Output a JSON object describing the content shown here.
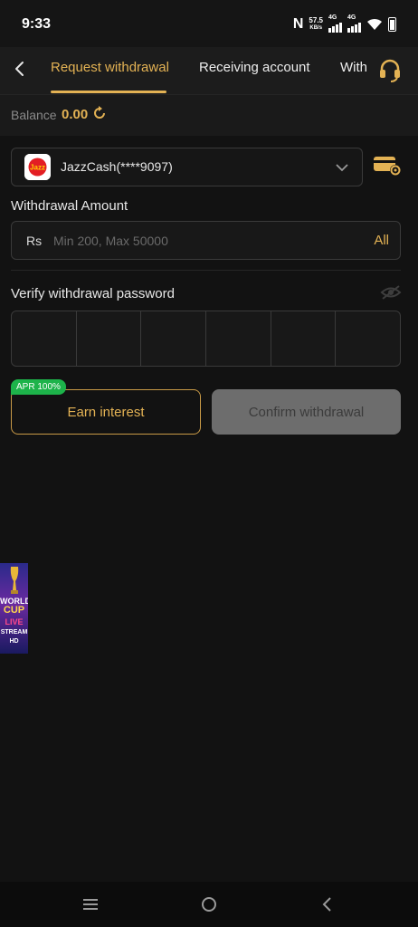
{
  "status_bar": {
    "time": "9:33",
    "network_speed": "57.5",
    "network_speed_unit": "KB/s",
    "signal_1_label": "4G",
    "signal_2_label": "4G",
    "n_icon": "N"
  },
  "tabs": [
    {
      "label": "Request withdrawal",
      "active": true
    },
    {
      "label": "Receiving account",
      "active": false
    },
    {
      "label": "Withdrawal record",
      "active": false
    }
  ],
  "balance": {
    "label": "Balance",
    "value": "0.00"
  },
  "account": {
    "name": "JazzCash(****9097)",
    "logo_text": "Jazz"
  },
  "amount": {
    "label": "Withdrawal Amount",
    "currency": "Rs",
    "placeholder": "Min 200, Max 50000",
    "all_label": "All"
  },
  "password": {
    "label": "Verify withdrawal password",
    "cells": 6
  },
  "actions": {
    "apr_badge": "APR 100%",
    "earn_label": "Earn interest",
    "confirm_label": "Confirm withdrawal"
  },
  "promo": {
    "line1": "WORLD",
    "line2": "CUP",
    "line3": "LIVE",
    "line4": "STREAM",
    "line5": "HD"
  },
  "colors": {
    "accent": "#e3b254",
    "background": "#121212",
    "apr_green": "#1db34a",
    "disabled_button": "#6d6d6d"
  }
}
